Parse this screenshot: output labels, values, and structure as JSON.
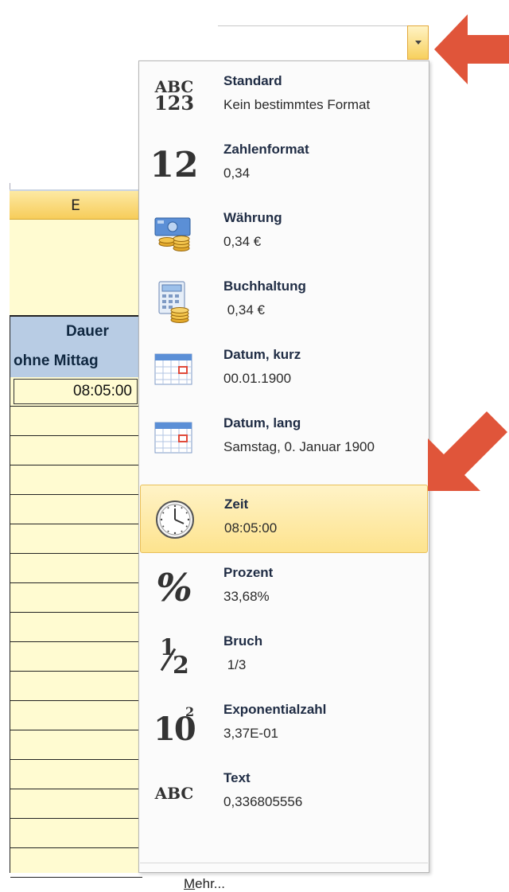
{
  "sheet": {
    "column_letter": "E",
    "header_line1": "Dauer",
    "header_line2": "ohne Mittag",
    "first_value": "08:05:00"
  },
  "menu": {
    "items": [
      {
        "name": "Standard",
        "example": "Kein bestimmtes Format",
        "icon": "abc-123-icon"
      },
      {
        "name": "Zahlenformat",
        "example": "0,34",
        "icon": "number-12-icon"
      },
      {
        "name": "Währung",
        "example": "0,34 €",
        "icon": "currency-icon"
      },
      {
        "name": "Buchhaltung",
        "example": " 0,34 €",
        "icon": "accounting-icon"
      },
      {
        "name": "Datum, kurz",
        "example": "00.01.1900",
        "icon": "calendar-short-icon"
      },
      {
        "name": "Datum, lang",
        "example": "Samstag, 0. Januar 1900",
        "icon": "calendar-long-icon"
      },
      {
        "name": "Zeit",
        "example": "08:05:00",
        "icon": "clock-icon",
        "selected": true
      },
      {
        "name": "Prozent",
        "example": "33,68%",
        "icon": "percent-icon"
      },
      {
        "name": "Bruch",
        "example": " 1/3",
        "icon": "fraction-icon"
      },
      {
        "name": "Exponentialzahl",
        "example": "3,37E-01",
        "icon": "exponent-icon"
      },
      {
        "name": "Text",
        "example": "0,336805556",
        "icon": "text-abc-icon"
      }
    ],
    "more_accel": "M",
    "more_rest": "ehr...",
    "icon_glyphs": {
      "abc": "ABC",
      "num": "123",
      "twelve": "12",
      "percent": "%",
      "half_num": "1",
      "half_den": "2",
      "ten": "10",
      "sup": "2"
    }
  },
  "colors": {
    "highlight": "#fde38e",
    "arrow": "#e0553a",
    "column_header": "#f7cd5a",
    "table_header": "#b8cce4"
  }
}
